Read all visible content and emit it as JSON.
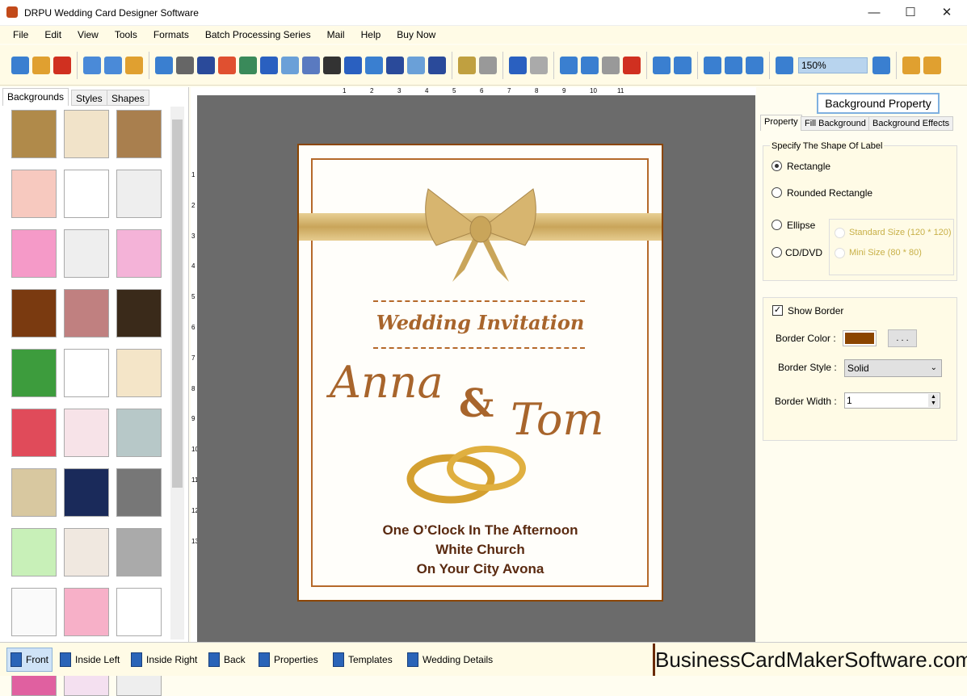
{
  "window": {
    "title": "DRPU Wedding Card Designer Software",
    "minimize": "—",
    "maximize": "☐",
    "close": "✕"
  },
  "menu": [
    "File",
    "Edit",
    "View",
    "Tools",
    "Formats",
    "Batch Processing Series",
    "Mail",
    "Help",
    "Buy Now"
  ],
  "toolbar": {
    "icons": [
      "new-icon",
      "open-icon",
      "close-icon",
      "save-icon",
      "save-as-icon",
      "export-icon",
      "page-setup-icon",
      "print-icon",
      "print-preview-icon",
      "gift-icon",
      "add-image-icon",
      "pen-icon",
      "shape-icon",
      "watermark-icon",
      "barcode-icon",
      "text-icon",
      "word-art-icon",
      "signature-icon",
      "email-icon",
      "line-icon",
      "database-icon",
      "database2-icon",
      "undo-icon",
      "redo-icon",
      "cut-icon",
      "copy-icon",
      "paste-icon",
      "delete-icon",
      "bring-front-icon",
      "send-back-icon",
      "grid-icon",
      "actual-size-icon",
      "fit-icon",
      "zoom-in-icon",
      "zoom-out-icon",
      "lock-icon",
      "unlock-icon"
    ],
    "zoom": "150%"
  },
  "left": {
    "tabs": [
      "Backgrounds",
      "Styles",
      "Shapes"
    ],
    "active_tab": "Backgrounds",
    "thumb_colors": [
      "#b08a4a",
      "#f1e3c9",
      "#a97f4e",
      "#f7c9bf",
      "#fff",
      "#eee",
      "#f59ac8",
      "#eee",
      "#f4b3d8",
      "#7a3a10",
      "#c08080",
      "#3a2a1a",
      "#3d9c3d",
      "#fff",
      "#f4e5c8",
      "#e04b5a",
      "#f7e3e8",
      "#b7c8c8",
      "#d8c8a0",
      "#1a2a5a",
      "#777",
      "#c8f0b8",
      "#f0e8e0",
      "#aaa",
      "#fafafa",
      "#f7b0c8",
      "#fff",
      "#e060a0",
      "#f4e0f0",
      "#eee"
    ]
  },
  "ruler": {
    "top": [
      "1",
      "2",
      "3",
      "4",
      "5",
      "6",
      "7",
      "8",
      "9",
      "10",
      "11"
    ],
    "left": [
      "1",
      "2",
      "3",
      "4",
      "5",
      "6",
      "7",
      "8",
      "9",
      "10",
      "11",
      "12",
      "13"
    ]
  },
  "card": {
    "heading": "Wedding Invitation",
    "name1": "Anna",
    "amp": "&",
    "name2": "Tom",
    "lines": [
      "One O’Clock In The Afternoon",
      "White Church",
      "On Your City Avona"
    ],
    "border_color": "#8b4500"
  },
  "right": {
    "title": "Background Property",
    "tabs": [
      "Property",
      "Fill Background",
      "Background Effects"
    ],
    "active_tab": "Property",
    "shape_group": "Specify The Shape Of Label",
    "shapes": [
      "Rectangle",
      "Rounded Rectangle",
      "Ellipse",
      "CD/DVD"
    ],
    "selected_shape": "Rectangle",
    "cd_sizes": [
      "Standard Size (120 * 120)",
      "Mini Size (80 * 80)"
    ],
    "show_border": "Show Border",
    "show_border_checked": true,
    "border_color_label": "Border Color :",
    "border_color": "#8b4500",
    "browse": ". . .",
    "border_style_label": "Border Style :",
    "border_style": "Solid",
    "border_width_label": "Border Width :",
    "border_width": "1"
  },
  "bottom": {
    "tabs": [
      "Front",
      "Inside Left",
      "Inside Right",
      "Back",
      "Properties",
      "Templates",
      "Wedding Details"
    ],
    "active": "Front",
    "brand": "BusinessCardMakerSoftware.com"
  }
}
